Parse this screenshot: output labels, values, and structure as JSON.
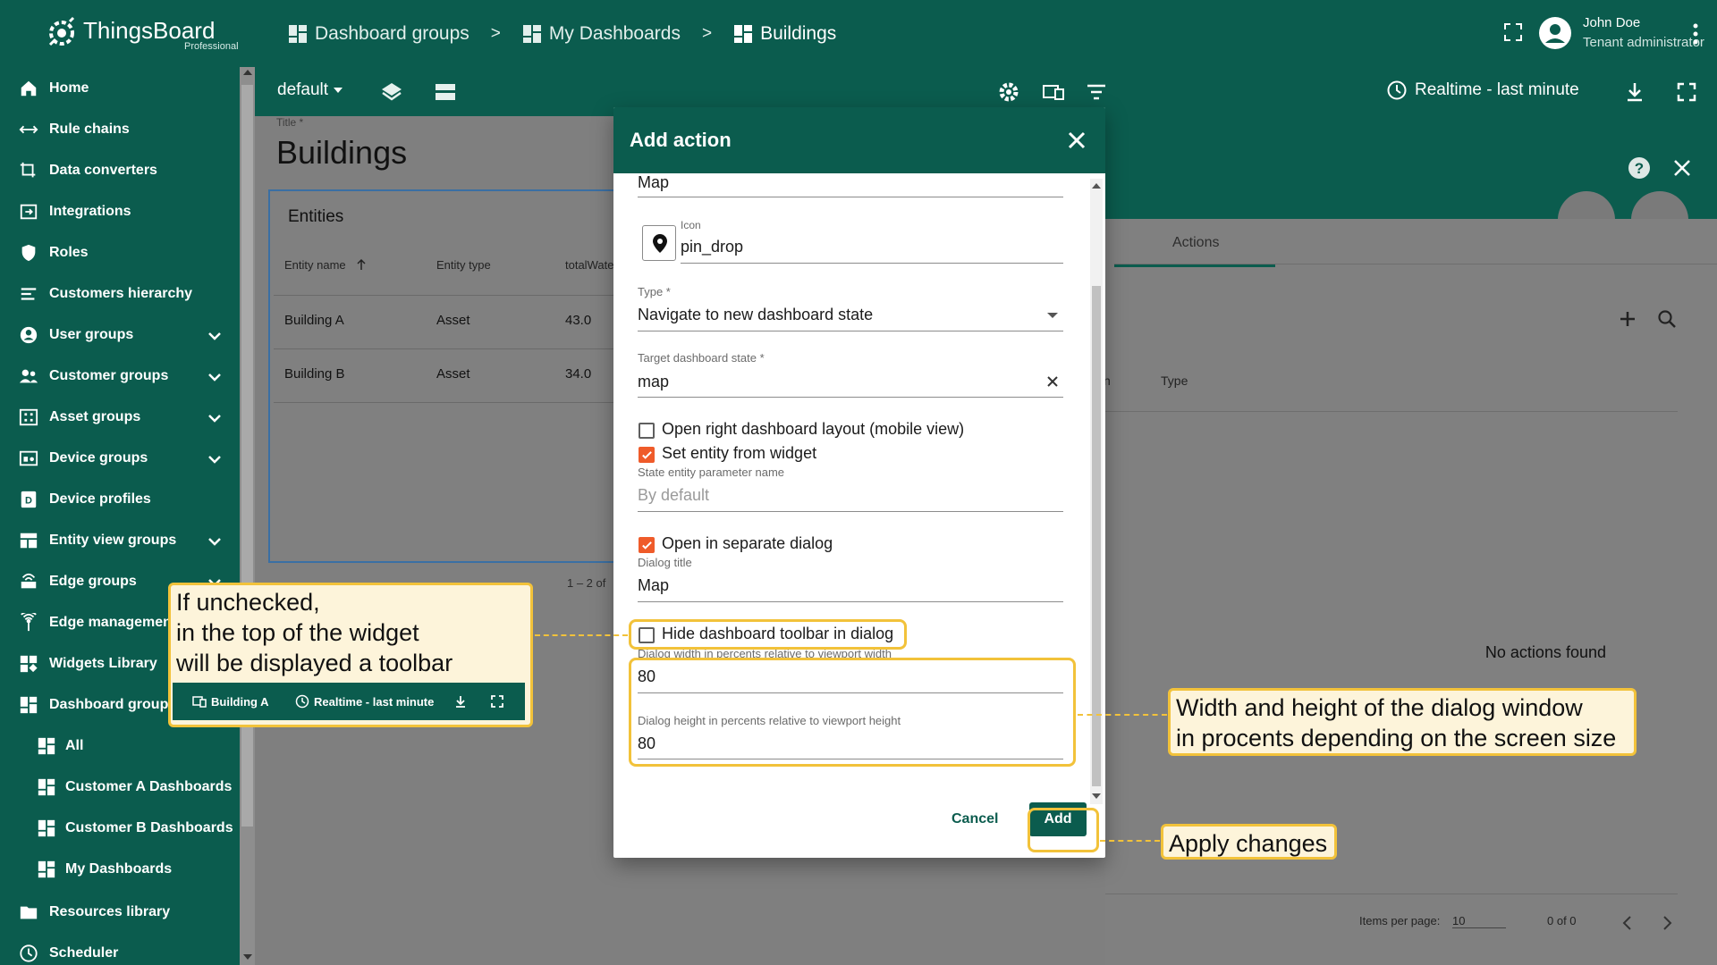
{
  "app": {
    "name": "ThingsBoard",
    "edition": "Professional"
  },
  "breadcrumb": [
    "Dashboard groups",
    "My Dashboards",
    "Buildings"
  ],
  "breadcrumb_sep": ">",
  "user": {
    "name": "John Doe",
    "role": "Tenant administrator"
  },
  "sidebar": {
    "items": [
      {
        "label": "Home",
        "icon": "home-icon"
      },
      {
        "label": "Rule chains",
        "icon": "rule-chain-icon"
      },
      {
        "label": "Data converters",
        "icon": "converter-icon"
      },
      {
        "label": "Integrations",
        "icon": "integration-icon"
      },
      {
        "label": "Roles",
        "icon": "shield-icon"
      },
      {
        "label": "Customers hierarchy",
        "icon": "hierarchy-icon"
      },
      {
        "label": "User groups",
        "icon": "account-icon",
        "expandable": true
      },
      {
        "label": "Customer groups",
        "icon": "people-icon",
        "expandable": true
      },
      {
        "label": "Asset groups",
        "icon": "asset-icon",
        "expandable": true
      },
      {
        "label": "Device groups",
        "icon": "device-icon",
        "expandable": true
      },
      {
        "label": "Device profiles",
        "icon": "device-profile-icon"
      },
      {
        "label": "Entity view groups",
        "icon": "entity-view-icon",
        "expandable": true
      },
      {
        "label": "Edge groups",
        "icon": "edge-icon",
        "expandable": true
      },
      {
        "label": "Edge management",
        "icon": "edge-management-icon"
      },
      {
        "label": "Widgets Library",
        "icon": "widgets-icon"
      },
      {
        "label": "Dashboard groups",
        "icon": "dashboard-icon"
      },
      {
        "label": "All",
        "icon": "dashboard-icon",
        "sub": true
      },
      {
        "label": "Customer A Dashboards",
        "icon": "dashboard-icon",
        "sub": true
      },
      {
        "label": "Customer B Dashboards",
        "icon": "dashboard-icon",
        "sub": true
      },
      {
        "label": "My Dashboards",
        "icon": "dashboard-icon",
        "sub": true
      },
      {
        "label": "Resources library",
        "icon": "folder-icon"
      },
      {
        "label": "Scheduler",
        "icon": "clock-icon"
      }
    ]
  },
  "dashboard": {
    "state": "default",
    "title_label": "Title *",
    "title": "Buildings",
    "realtime": "Realtime - last minute",
    "widget": {
      "title": "Entities",
      "columns": [
        "Entity name",
        "Entity type",
        "totalWate"
      ],
      "rows": [
        [
          "Building A",
          "Asset",
          "43.0"
        ],
        [
          "Building B",
          "Asset",
          "34.0"
        ]
      ],
      "paging": "1 – 2 of"
    }
  },
  "panel": {
    "tab": "Actions",
    "columns": [
      "n",
      "Type"
    ],
    "empty": "No actions found",
    "items_per_page_label": "Items per page:",
    "items_per_page": "10",
    "range": "0 of 0"
  },
  "dialog": {
    "title": "Add action",
    "name_value": "Map",
    "icon_label": "Icon",
    "icon_value": "pin_drop",
    "type_label": "Type *",
    "type_value": "Navigate to new dashboard state",
    "target_label": "Target dashboard state *",
    "target_value": "map",
    "chk_open_right": "Open right dashboard layout (mobile view)",
    "chk_set_entity": "Set entity from widget",
    "state_param_label": "State entity parameter name",
    "state_param_placeholder": "By default",
    "chk_separate_dialog": "Open in separate dialog",
    "dialog_title_label": "Dialog title",
    "dialog_title_value": "Map",
    "chk_hide_toolbar": "Hide dashboard toolbar in dialog",
    "width_label": "Dialog width in percents relative to viewport width",
    "width_value": "80",
    "height_label": "Dialog height in percents relative to viewport height",
    "height_value": "80",
    "cancel": "Cancel",
    "add": "Add",
    "checks": {
      "open_right": false,
      "set_entity": true,
      "separate_dialog": true,
      "hide_toolbar": false
    }
  },
  "callouts": {
    "toolbar_line1": "If unchecked,",
    "toolbar_line2": "in the top of the widget",
    "toolbar_line3": "will be displayed a toolbar",
    "mini_entity": "Building A",
    "mini_realtime": "Realtime - last minute",
    "size_line1": "Width and height of the dialog window",
    "size_line2": "in procents depending on the screen size",
    "apply": "Apply changes"
  },
  "colors": {
    "primary": "#0b5c4e",
    "accent": "#ef5b2a",
    "highlight": "#f2c23a",
    "callout_bg": "#fdf4da"
  }
}
